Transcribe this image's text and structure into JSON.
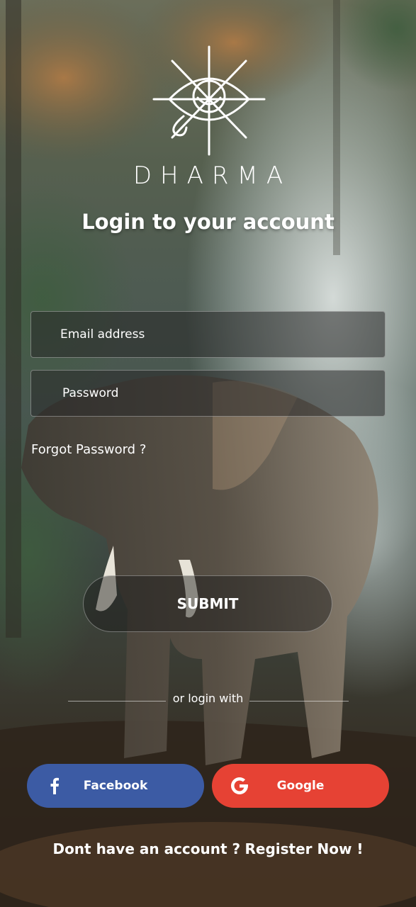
{
  "brand": {
    "logo_icon": "eye-sun-icon",
    "name": "DHARMA"
  },
  "login": {
    "headline": "Login to your account",
    "email_placeholder": "Email address",
    "password_placeholder": "Password",
    "forgot_label": "Forgot Password ?",
    "submit_label": "SUBMIT"
  },
  "social": {
    "divider_label": "or login with",
    "facebook": {
      "label": "Facebook",
      "icon": "facebook-icon",
      "color": "#3c5ba4"
    },
    "google": {
      "label": "Google",
      "icon": "google-icon",
      "color": "#e64234"
    }
  },
  "register": {
    "question": "Dont have an account ?",
    "link_label": "Register Now !"
  }
}
